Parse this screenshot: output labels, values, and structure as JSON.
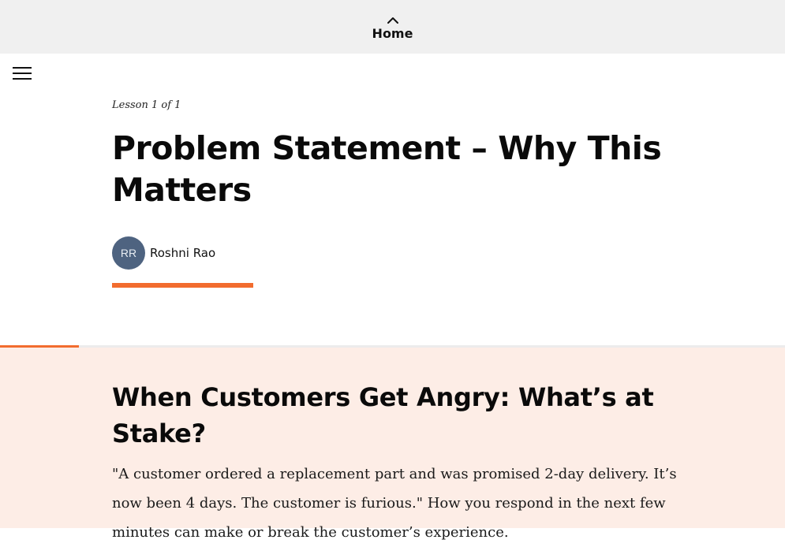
{
  "nav": {
    "home_label": "Home",
    "home_icon": "chevron-up-icon",
    "menu_icon": "hamburger-menu-icon"
  },
  "lesson": {
    "counter": "Lesson 1 of 1",
    "title": "Problem Statement – Why This Matters",
    "author": {
      "initials": "RR",
      "name": "Roshni Rao"
    },
    "progress_fraction": 0.1
  },
  "content": {
    "heading": "When Customers Get Angry: What’s at Stake?",
    "paragraph": "\"A customer ordered a replacement part and was promised 2-day delivery. It’s now been 4 days. The customer is furious.\" How you respond in the next few minutes can make or break the customer’s experience."
  },
  "colors": {
    "accent": "#f26c2e",
    "content_background": "#fdede6",
    "topbar_background": "#f0f0f0",
    "avatar_background": "#4e6380"
  }
}
